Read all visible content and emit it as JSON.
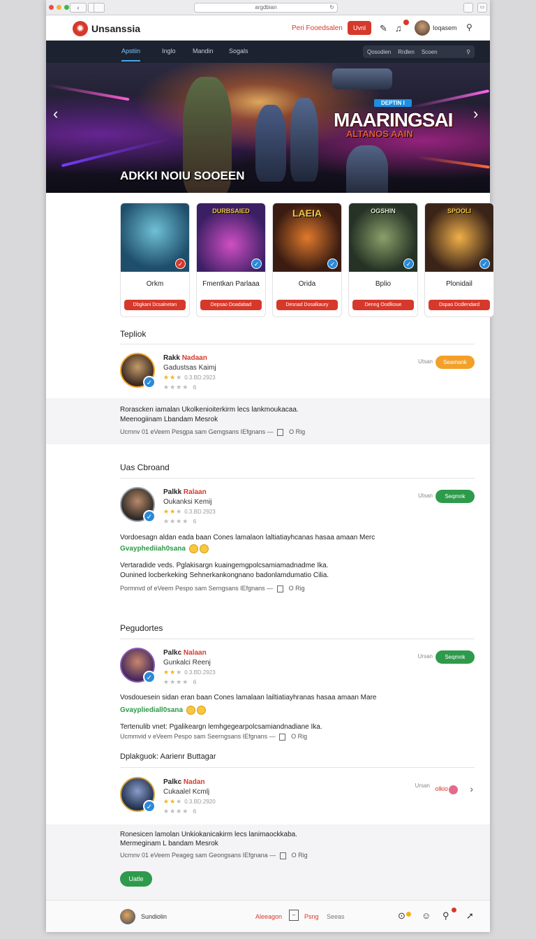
{
  "browser": {
    "url": "argdbian"
  },
  "header": {
    "brand": "Unsanssia",
    "link": "Peri Fooedsalen",
    "button": "Uvnl",
    "user": "Ioqasem"
  },
  "subnav": {
    "tabs": [
      "Apstiin",
      "Inglo",
      "Mandin",
      "Sogals"
    ],
    "filters": [
      "Qosodien",
      "Rrdlen",
      "Scoen"
    ]
  },
  "hero": {
    "badge": "DEPTIN I",
    "headline": "MAARINGSAI",
    "subheadline": "ALTANOS AAIN",
    "title": "ADKKI NOIU SOOEEN"
  },
  "cards": [
    {
      "title": "Orkm",
      "button": "Dbgkani Dcsalnetan",
      "tick_color": "#d6392b",
      "image_text": ""
    },
    {
      "title": "Fmentkan Parlaaa",
      "button": "Depsao Doadabad",
      "tick_color": "#2b8ad8",
      "image_text": "DURBSAIED"
    },
    {
      "title": "Orida",
      "button": "Desnad Dosalkaury",
      "tick_color": "#2b8ad8",
      "image_text": "LAEIA"
    },
    {
      "title": "Bplio",
      "button": "Denng Oodlkoue",
      "tick_color": "#2b8ad8",
      "image_text": "OGSHIN"
    },
    {
      "title": "Plonidail",
      "button": "Dspao Dcdlendard",
      "tick_color": "#2b8ad8",
      "image_text": "SPOOLI"
    }
  ],
  "sections": {
    "s1": "Tepliok",
    "s2": "Uas Cbroand",
    "s3": "Pegudortes",
    "s4": "Dplakguok: Aarienr Buttagar"
  },
  "reviews": [
    {
      "name_plain": "Rakk",
      "name_highlight": "Nadaan",
      "subtitle": "Gadustsas Kaimj",
      "meta": "0.3.BD.2923",
      "count": "6",
      "label": "Utsan",
      "button": "Seamank",
      "button_color": "#f3a02a",
      "tag": "",
      "body1": "Rorascken iamalan Ukolkenioiterkirm lecs lankmoukacaa.",
      "body2": "Meenogiinam Lbandam Mesrok",
      "body3": "",
      "footer": "Ucrnnv 01 eVeem Pesgpa sam Gemgsans IEfgnans",
      "footer_end": "O Rig"
    },
    {
      "name_plain": "Palkk",
      "name_highlight": "Ralaan",
      "subtitle": "Oukanksi Kemij",
      "meta": "0.3.BD.2923",
      "count": "6",
      "label": "Utsan",
      "button": "Seqmnk",
      "button_color": "#2e9a4b",
      "tag": "Gvayphediiah0sana",
      "body1": "Vordoesagn aldan eada baan Cones lamalaon laltiatiayhcanas hasaa amaan Merc",
      "body2": "Vertaradide veds. Pglakisargn kuaingemgpolcsamiamadnadme Ika.",
      "body3": "Ounined locberkeking Sehnerkankongnano badonlamdumatio Cilia.",
      "footer": "Pormnvd of eVeem Pespo sam Serngsans IEfgnans",
      "footer_end": "O Rig"
    },
    {
      "name_plain": "Palkc",
      "name_highlight": "Nalaan",
      "subtitle": "Gunkalci Reenj",
      "meta": "0.3.BD.2923",
      "count": "6",
      "label": "Ursan",
      "button": "Seqmnk",
      "button_color": "#2e9a4b",
      "tag": "Gvaypliediall0sana",
      "body1": "Vosdouesein sidan eran baan Cones lamalaan lailtiatiayhranas hasaa amaan Mare",
      "body2": "Tertenulib vnet: Pgalikeargn lemhgegearpolcsamiandnadiane Ika.",
      "body3": "Ucmmvid v eVeem Pespo sam Seerngsans IEfgnans",
      "footer": "",
      "footer_end": "O Rig"
    },
    {
      "name_plain": "Palkc",
      "name_highlight": "Nadan",
      "subtitle": "Cukaalel Kcmlj",
      "meta": "0.3.BD.2920",
      "count": "6",
      "label": "Ursan",
      "button": "olkio",
      "button_color": "#e46a8c",
      "tag": "",
      "body1": "Ronesicen lamolan Unkiokanicakirm lecs lanimaockkaba.",
      "body2": "Mermeginam L bandam Mesrok",
      "body3": "",
      "footer": "Ucrnnv 01 eVeem Peageg sam Geongsans IEfgnana",
      "footer_end": "O Rig"
    }
  ],
  "bottom_button": "Uatle",
  "footer": {
    "user": "Sundiolin",
    "links": [
      "Aleeagon",
      "Psng",
      "Seeas"
    ]
  }
}
